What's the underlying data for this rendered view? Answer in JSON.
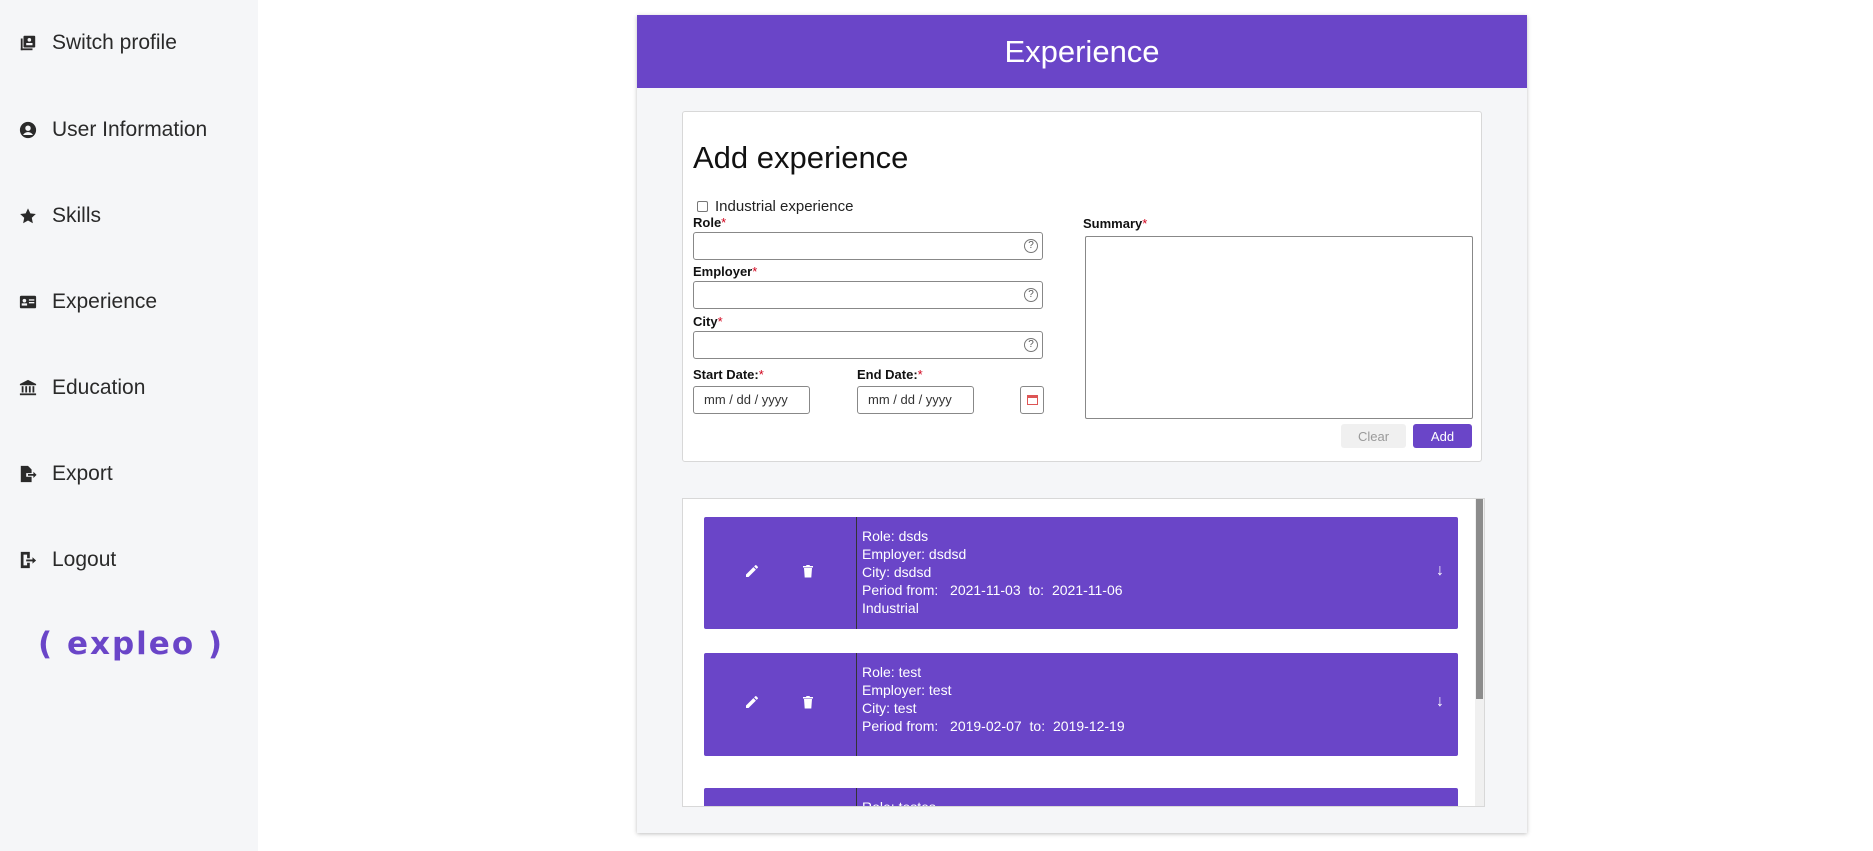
{
  "sidebar": {
    "items": [
      {
        "label": "Switch profile",
        "icon": "switch-profile-icon"
      },
      {
        "label": "User Information",
        "icon": "user-icon"
      },
      {
        "label": "Skills",
        "icon": "star-icon"
      },
      {
        "label": "Experience",
        "icon": "id-card-icon"
      },
      {
        "label": "Education",
        "icon": "institution-icon"
      },
      {
        "label": "Export",
        "icon": "export-icon"
      },
      {
        "label": "Logout",
        "icon": "logout-icon"
      }
    ],
    "logo": "( expleo )"
  },
  "header": {
    "title": "Experience"
  },
  "form": {
    "title": "Add experience",
    "industrial_label": "Industrial experience",
    "role_label": "Role",
    "employer_label": "Employer",
    "city_label": "City",
    "start_label": "Start Date:",
    "end_label": "End Date:",
    "date_placeholder": "mm / dd / yyyy",
    "summary_label": "Summary",
    "required_mark": "*",
    "help_glyph": "?",
    "clear_label": "Clear",
    "add_label": "Add"
  },
  "experiences": [
    {
      "role": "Role: dsds",
      "employer": "Employer: dsdsd",
      "city": "City: dsdsd",
      "period_prefix": "Period from:",
      "from": "2021-11-03",
      "to_prefix": "to:",
      "to": "2021-11-06",
      "type": "Industrial",
      "arrow": "↓"
    },
    {
      "role": "Role: test",
      "employer": "Employer: test",
      "city": "City: test",
      "period_prefix": "Period from:",
      "from": "2019-02-07",
      "to_prefix": "to:",
      "to": "2019-12-19",
      "type": "",
      "arrow": "↓"
    },
    {
      "role": "Role: testes"
    }
  ],
  "colors": {
    "accent": "#6a45c8",
    "sidebar_bg": "#f5f6f8",
    "required": "#d0021b"
  }
}
